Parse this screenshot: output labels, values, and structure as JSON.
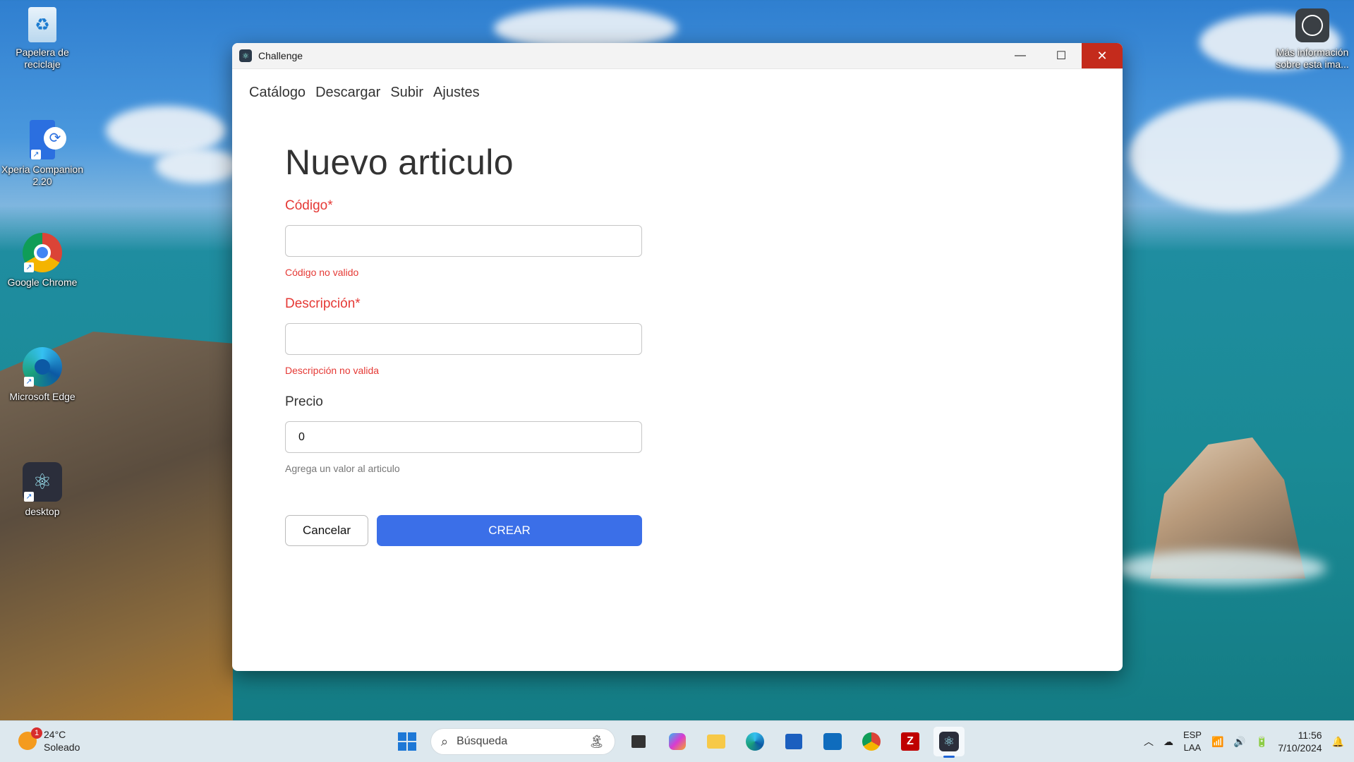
{
  "desktop": {
    "icons": [
      {
        "label": "Papelera de reciclaje",
        "icon": "recycle-bin-icon"
      },
      {
        "label": "Xperia Companion 2.20",
        "icon": "xperia-icon"
      },
      {
        "label": "Google Chrome",
        "icon": "chrome-icon"
      },
      {
        "label": "Microsoft Edge",
        "icon": "edge-icon"
      },
      {
        "label": "desktop",
        "icon": "electron-icon"
      }
    ],
    "info_widget": {
      "label": "Más información sobre esta ima...",
      "icon": "camera-icon"
    }
  },
  "window": {
    "title": "Challenge",
    "controls": {
      "minimize": "—",
      "maximize": "☐",
      "close": "✕"
    },
    "nav": [
      "Catálogo",
      "Descargar",
      "Subir",
      "Ajustes"
    ],
    "form": {
      "title": "Nuevo articulo",
      "codigo": {
        "label": "Código*",
        "value": "",
        "error": "Código no valido"
      },
      "descripcion": {
        "label": "Descripción*",
        "value": "",
        "error": "Descripción no valida"
      },
      "precio": {
        "label": "Precio",
        "value": "0",
        "helper": "Agrega un valor al articulo"
      },
      "cancel_label": "Cancelar",
      "create_label": "CREAR"
    },
    "colors": {
      "error": "#e53935",
      "primary": "#3b6fe8"
    }
  },
  "taskbar": {
    "weather": {
      "temp": "24°C",
      "condition": "Soleado",
      "badge": "1"
    },
    "search_placeholder": "Búsqueda",
    "apps": [
      "task-view-icon",
      "copilot-icon",
      "file-explorer-icon",
      "edge-icon",
      "store-icon",
      "outlook-icon",
      "chrome-icon",
      "filezilla-icon",
      "electron-icon"
    ],
    "tray": {
      "lang_top": "ESP",
      "lang_bottom": "LAA",
      "time": "11:56",
      "date": "7/10/2024"
    }
  }
}
